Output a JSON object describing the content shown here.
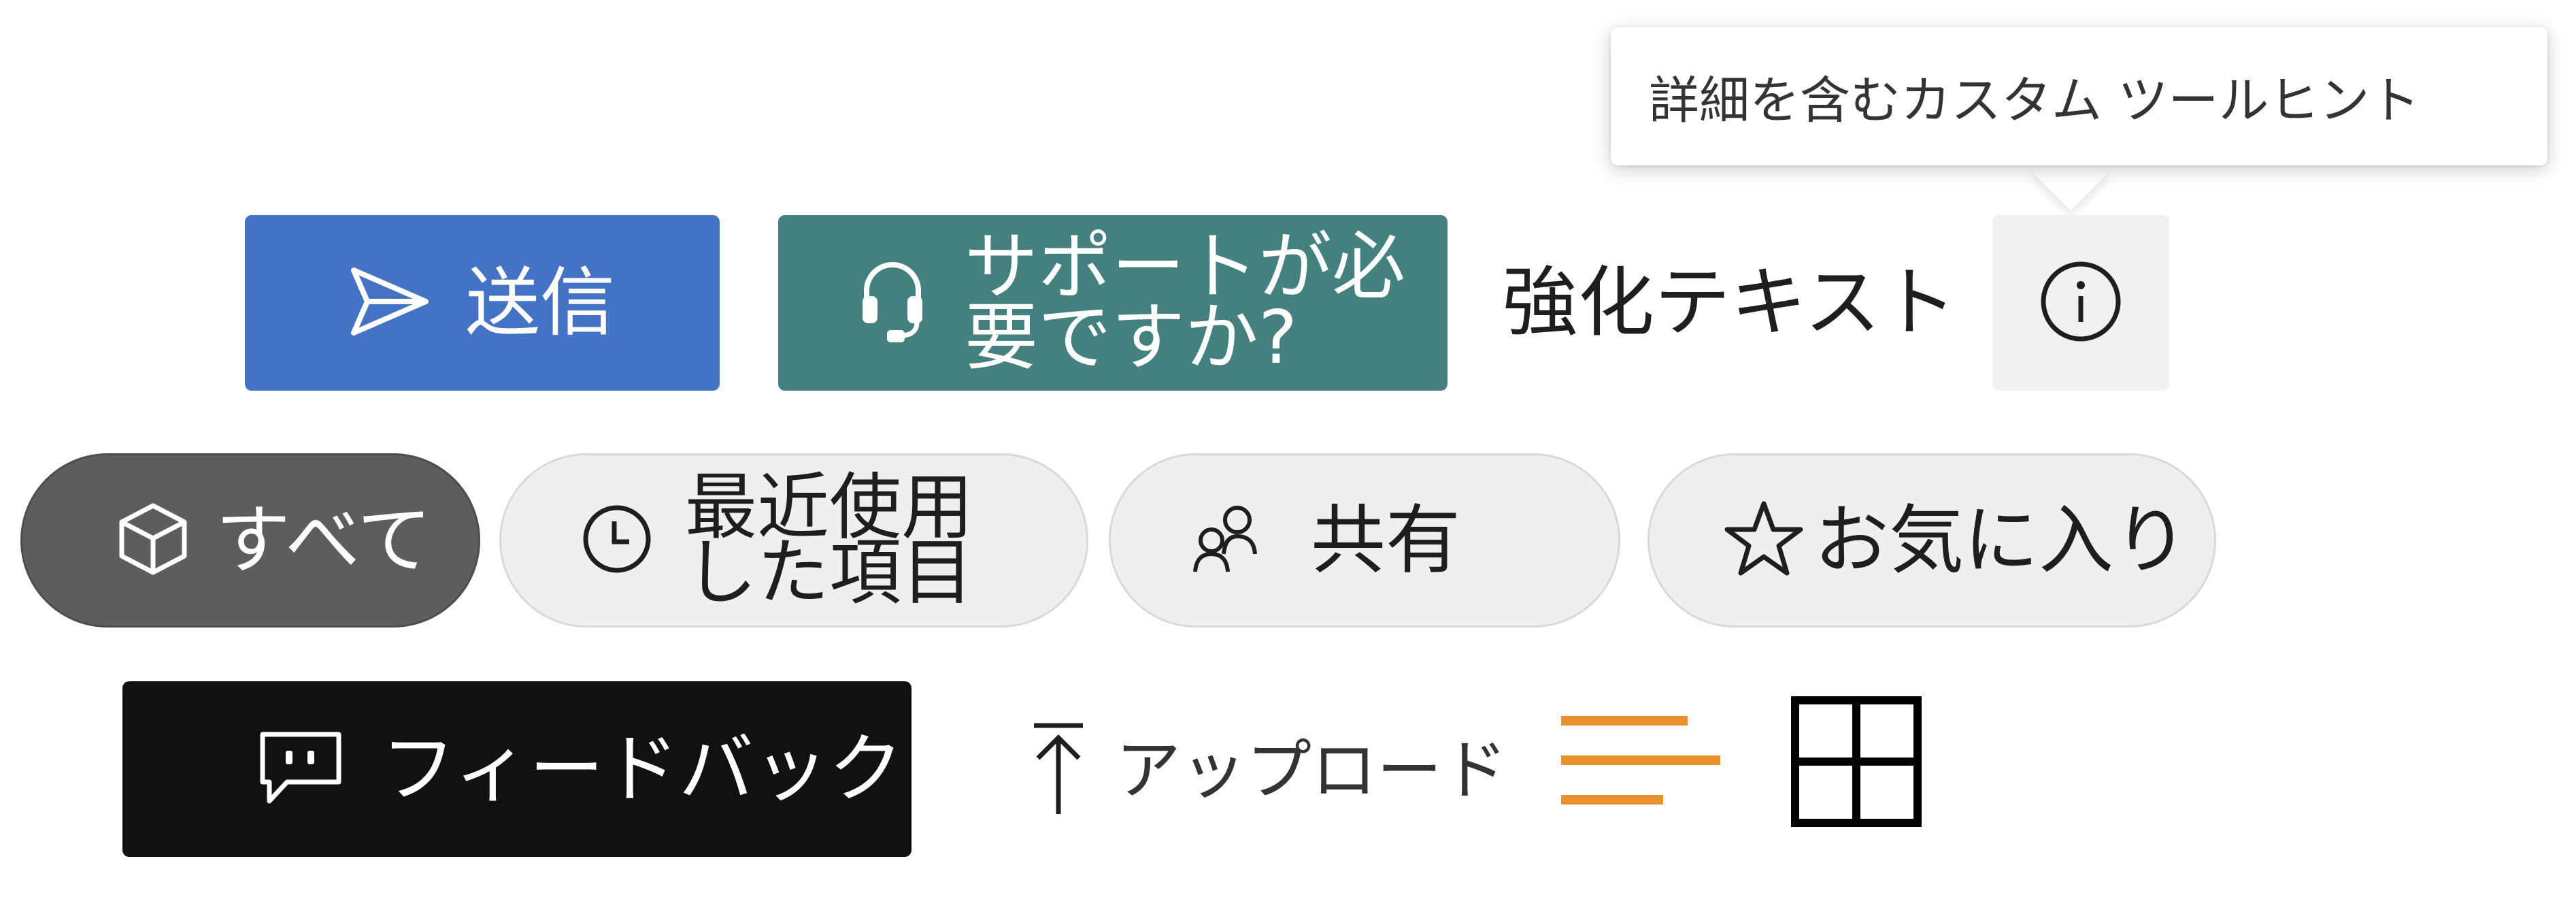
{
  "buttons": {
    "send": {
      "label": "送信",
      "icon": "send-icon",
      "bg": "#4472c4"
    },
    "help": {
      "label_line1": "サポートが必",
      "label_line2": "要ですか?",
      "icon": "headset-icon",
      "bg": "#43807e"
    },
    "emphasized_text": "強化テキスト",
    "info": {
      "icon": "info-icon"
    },
    "feedback": {
      "label": "フィードバック",
      "icon": "comment-icon",
      "bg": "#111111"
    },
    "upload": {
      "label": "アップロード",
      "icon": "upload-icon"
    }
  },
  "tooltip": {
    "text": "詳細を含むカスタム ツールヒント"
  },
  "pills": [
    {
      "label": "すべて",
      "icon": "cube-icon",
      "selected": true
    },
    {
      "label_line1": "最近使用",
      "label_line2": "した項目",
      "icon": "clock-icon",
      "selected": false
    },
    {
      "label": "共有",
      "icon": "people-icon",
      "selected": false
    },
    {
      "label": "お気に入り",
      "icon": "star-icon",
      "selected": false
    }
  ],
  "icons": {
    "menu": {
      "name": "menu-lines-icon",
      "color": "#e8912d"
    },
    "grid": {
      "name": "grid-icon",
      "color": "#000000"
    }
  }
}
